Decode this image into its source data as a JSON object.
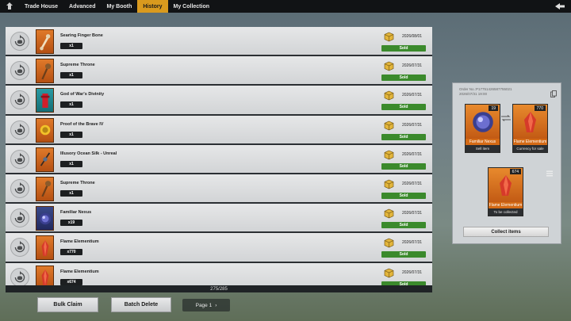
{
  "nav": {
    "tabs": [
      {
        "label": "Trade House"
      },
      {
        "label": "Advanced"
      },
      {
        "label": "My Booth"
      },
      {
        "label": "History"
      },
      {
        "label": "My Collection"
      }
    ],
    "active_tab": "History"
  },
  "history": {
    "rows": [
      {
        "name": "Searing Finger Bone",
        "qty": "x1",
        "date": "2026/08/01",
        "status": "Sold",
        "icon": "bone-icon"
      },
      {
        "name": "Supreme Throne",
        "qty": "x1",
        "date": "2026/07/31",
        "status": "Sold",
        "icon": "staff-icon"
      },
      {
        "name": "God of War's Divinity",
        "qty": "x1",
        "date": "2026/07/31",
        "status": "Sold",
        "icon": "red-relic-icon"
      },
      {
        "name": "Proof of the Brave IV",
        "qty": "x1",
        "date": "2026/07/31",
        "status": "Sold",
        "icon": "gold-badge-icon"
      },
      {
        "name": "Illusory Ocean Silk - Unreal",
        "qty": "x1",
        "date": "2026/07/31",
        "status": "Sold",
        "icon": "silk-icon"
      },
      {
        "name": "Supreme Throne",
        "qty": "x1",
        "date": "2026/07/31",
        "status": "Sold",
        "icon": "staff-icon"
      },
      {
        "name": "Familiar Nexus",
        "qty": "x19",
        "date": "2026/07/31",
        "status": "Sold",
        "icon": "nexus-orb-icon"
      },
      {
        "name": "Flame Elementium",
        "qty": "x770",
        "date": "2026/07/31",
        "status": "Sold",
        "icon": "crystal-icon"
      },
      {
        "name": "Flame Elementium",
        "qty": "x674",
        "date": "2026/07/31",
        "status": "Sold",
        "icon": "crystal-icon"
      }
    ],
    "counter": "275/285"
  },
  "actions": {
    "bulk_claim": "Bulk Claim",
    "batch_delete": "Batch Delete",
    "page": "Page 1"
  },
  "order": {
    "order_no": "Order No.:P17751426587755021",
    "order_time": "2026/07/31 19:00",
    "sell": {
      "name": "Familiar Nexus",
      "count": "19",
      "label": "Sell item"
    },
    "receive": {
      "name": "Flame Elementium",
      "count": "770",
      "label": "Currency for sale"
    },
    "collect": {
      "name": "Flame Elementium",
      "count": "674",
      "label": "To be collected"
    },
    "collect_button": "Collect items"
  },
  "colors": {
    "accent_tab": "#d99a1e",
    "sold_green": "#3b8a2c",
    "item_orange": "#d46a16"
  }
}
